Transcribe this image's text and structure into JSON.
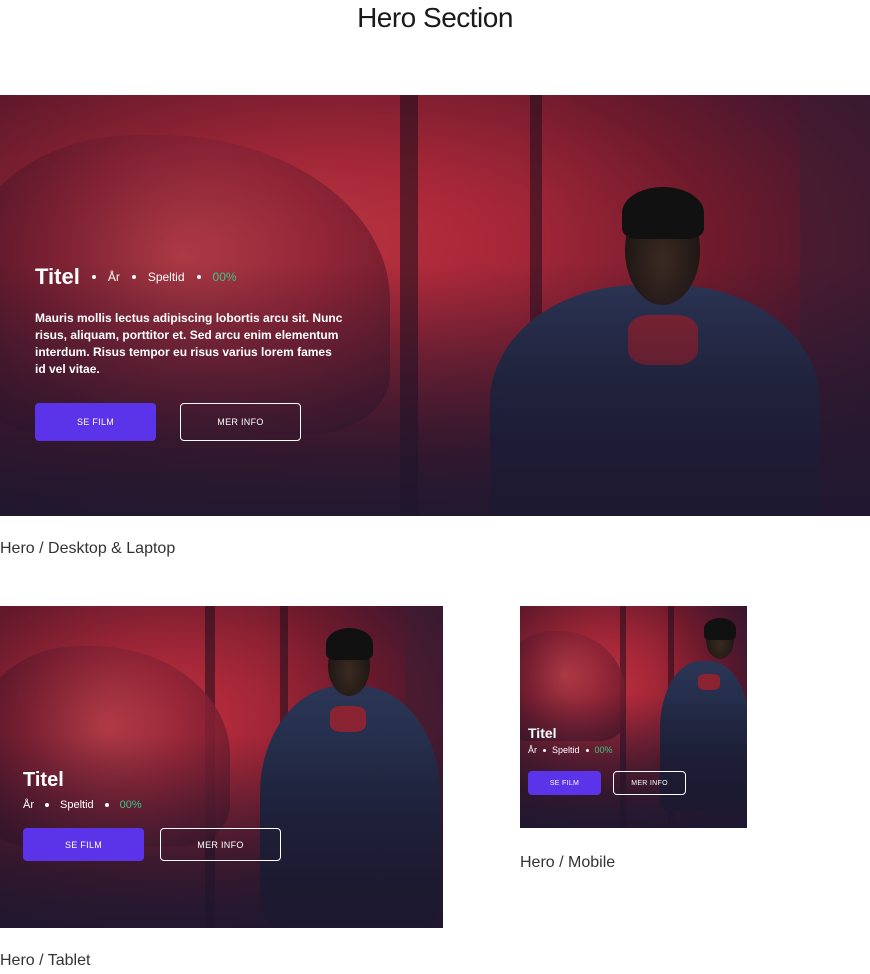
{
  "page": {
    "title": "Hero Section"
  },
  "hero": {
    "title": "Titel",
    "year": "År",
    "runtime": "Speltid",
    "match": "00%",
    "description": "Mauris mollis lectus adipiscing lobortis arcu sit. Nunc risus, aliquam, porttitor et. Sed arcu enim elementum interdum. Risus tempor eu risus varius lorem fames id vel vitae.",
    "primary_button": "SE FILM",
    "secondary_button": "MER INFO"
  },
  "captions": {
    "desktop": "Hero / Desktop & Laptop",
    "tablet": "Hero / Tablet",
    "mobile": "Hero / Mobile"
  },
  "colors": {
    "accent": "#5b34ea",
    "match": "#3ec48a",
    "text": "#ffffff"
  }
}
